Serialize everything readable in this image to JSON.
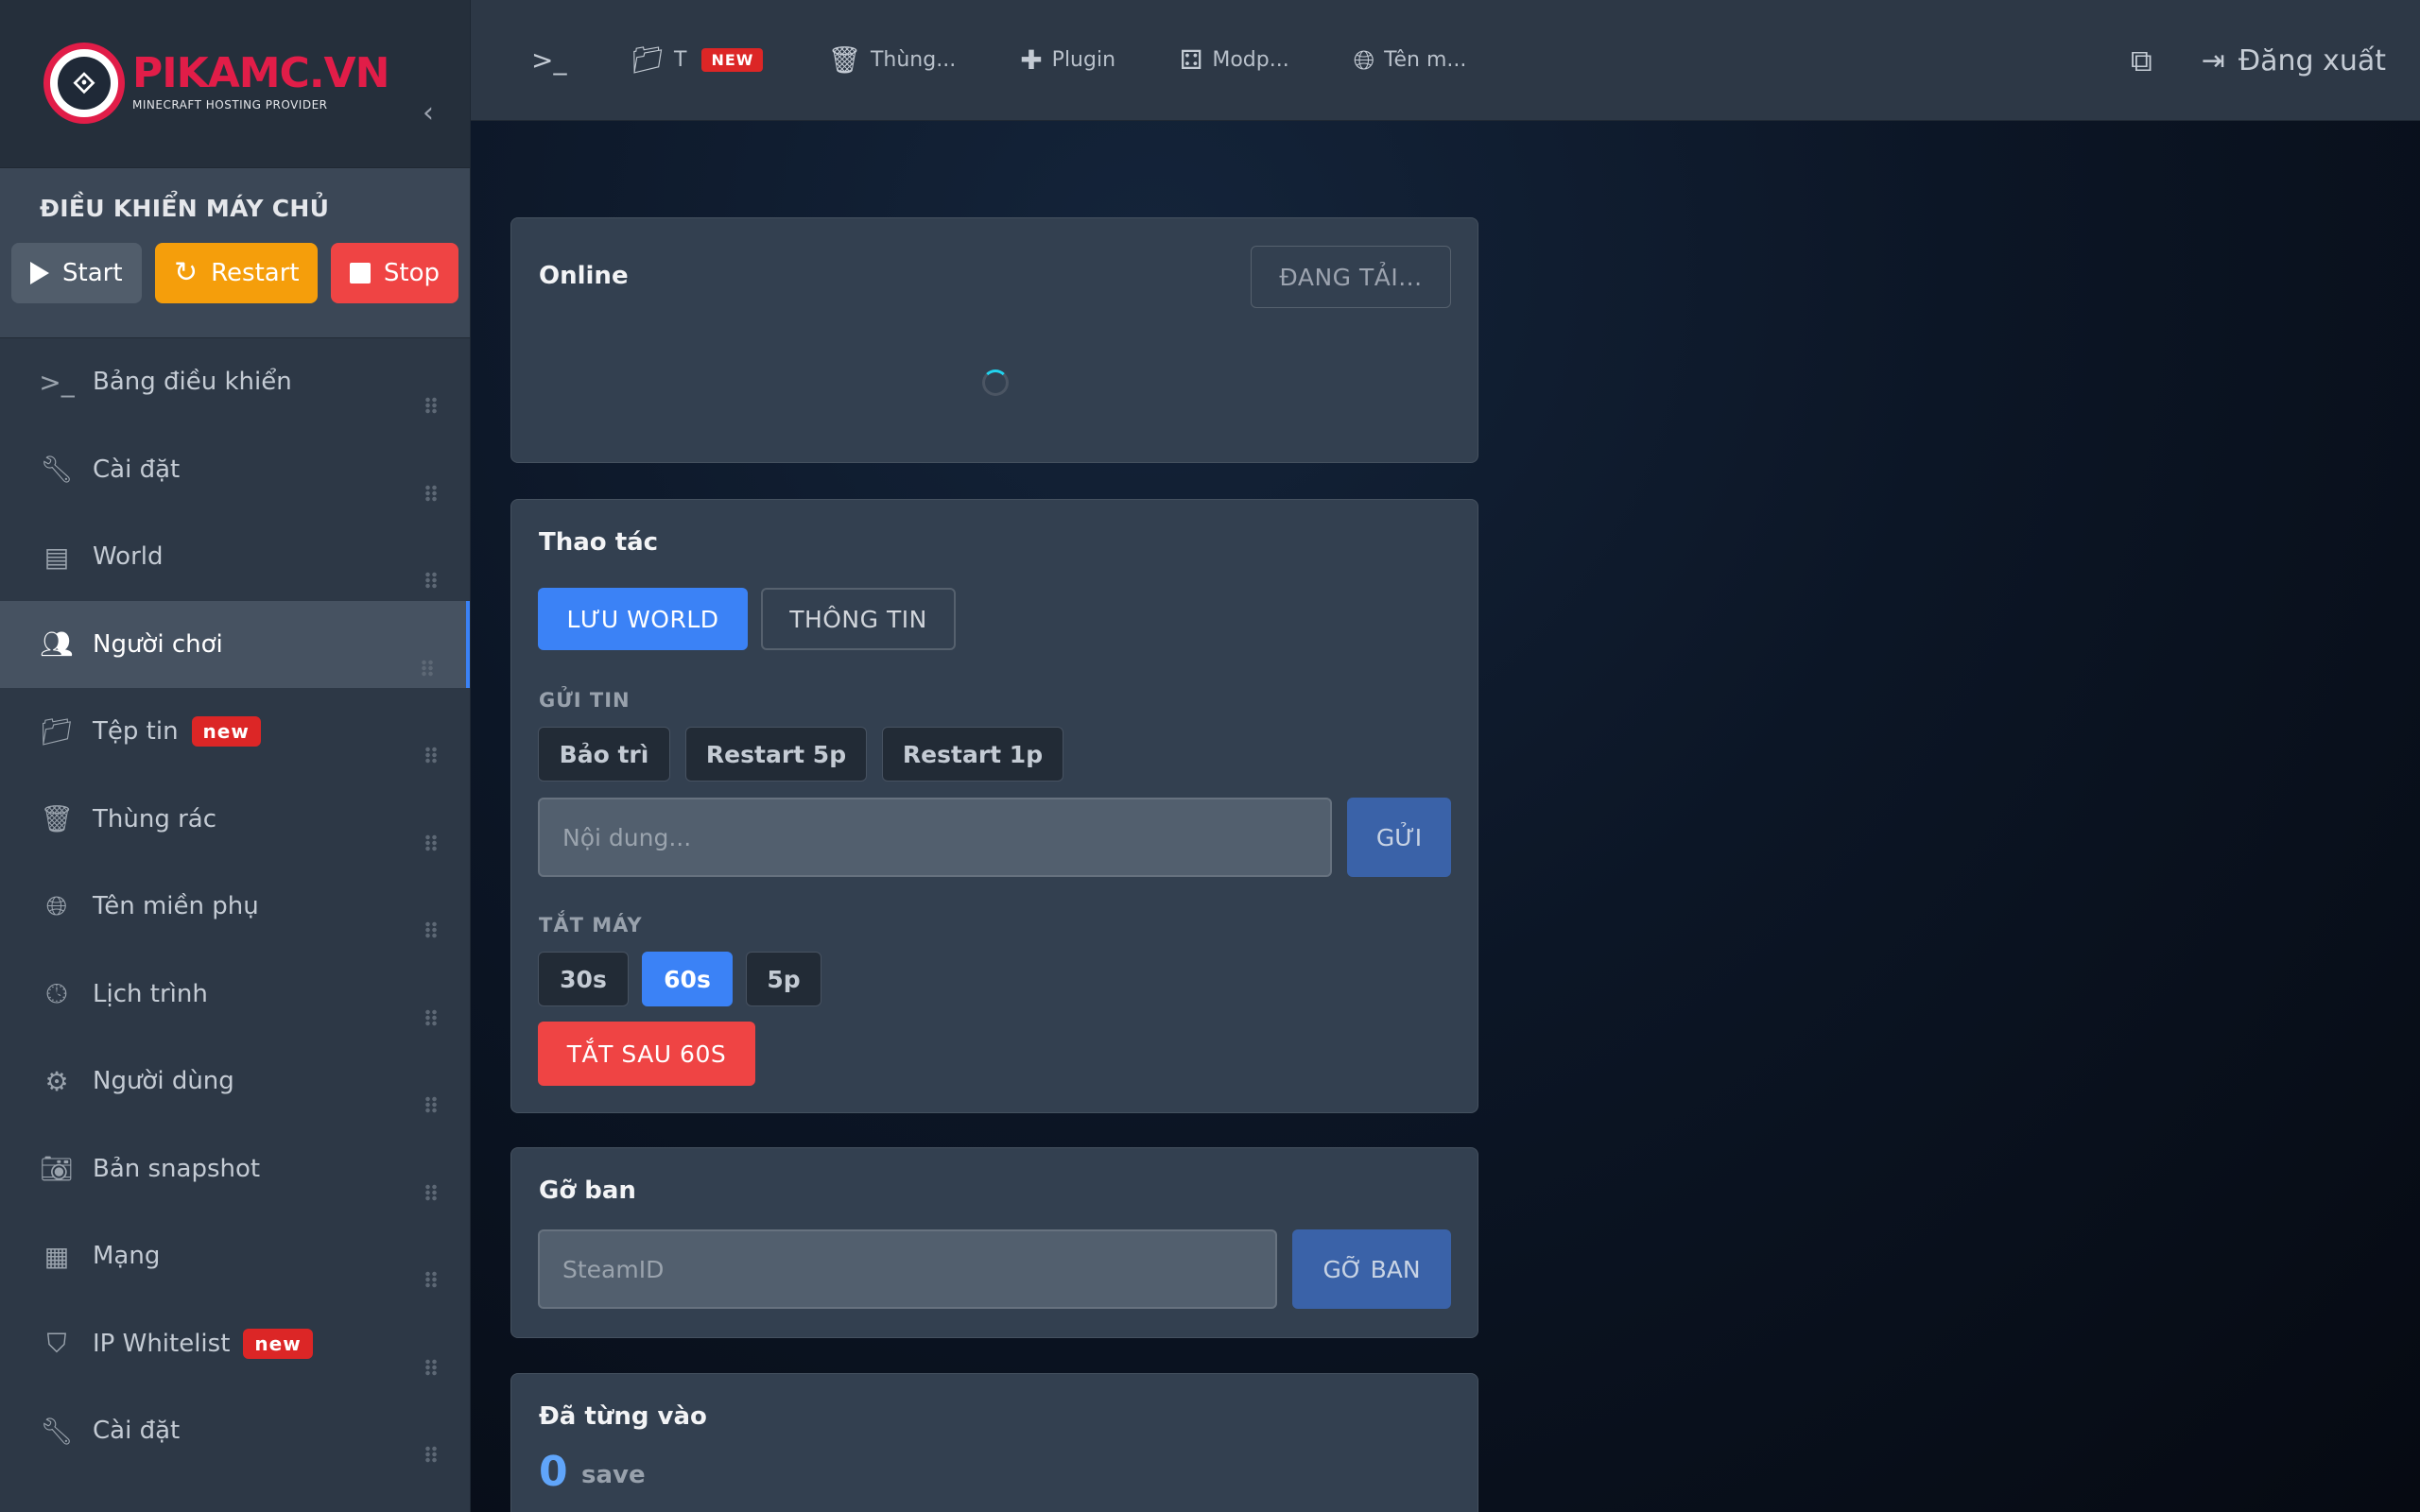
{
  "brand": {
    "name": "PIKAMC.VN",
    "tagline": "MINECRAFT HOSTING PROVIDER"
  },
  "server_control": {
    "title": "ĐIỀU KHIỂN MÁY CHỦ",
    "start_label": "Start",
    "restart_label": "Restart",
    "stop_label": "Stop"
  },
  "sidebar": {
    "items": [
      {
        "label": "Bảng điều khiển",
        "icon": "terminal-icon"
      },
      {
        "label": "Cài đặt",
        "icon": "wrench-icon"
      },
      {
        "label": "World",
        "icon": "archive-icon"
      },
      {
        "label": "Người chơi",
        "icon": "users-icon",
        "active": true
      },
      {
        "label": "Tệp tin",
        "icon": "folder-icon",
        "badge": "new"
      },
      {
        "label": "Thùng rác",
        "icon": "trash-icon"
      },
      {
        "label": "Tên miền phụ",
        "icon": "globe-icon"
      },
      {
        "label": "Lịch trình",
        "icon": "clock-icon"
      },
      {
        "label": "Người dùng",
        "icon": "user-gear-icon"
      },
      {
        "label": "Bản snapshot",
        "icon": "camera-icon"
      },
      {
        "label": "Mạng",
        "icon": "network-icon"
      },
      {
        "label": "IP Whitelist",
        "icon": "shield-icon",
        "badge": "new"
      },
      {
        "label": "Cài đặt",
        "icon": "wrench-icon"
      }
    ]
  },
  "topbar": {
    "items": [
      {
        "label": "",
        "icon": "terminal-icon"
      },
      {
        "label": "T",
        "icon": "folder-icon",
        "badge": "NEW"
      },
      {
        "label": "Thùng...",
        "icon": "trash-icon"
      },
      {
        "label": "Plugin",
        "icon": "puzzle-icon"
      },
      {
        "label": "Modp...",
        "icon": "cubes-icon"
      },
      {
        "label": "Tên m...",
        "icon": "globe-icon"
      }
    ],
    "logout_label": "Đăng xuất"
  },
  "online_card": {
    "title": "Online",
    "loading_label": "ĐANG TẢI..."
  },
  "actions_card": {
    "title": "Thao tác",
    "save_world_label": "LƯU WORLD",
    "info_label": "THÔNG TIN",
    "send_msg_section": "GỬI TIN",
    "presets": [
      "Bảo trì",
      "Restart 5p",
      "Restart 1p"
    ],
    "message_placeholder": "Nội dung...",
    "send_label": "GỬI",
    "shutdown_section": "TẮT MÁY",
    "timers": [
      "30s",
      "60s",
      "5p"
    ],
    "selected_timer": "60s",
    "shutdown_label": "TẮT SAU 60S"
  },
  "unban_card": {
    "title": "Gỡ ban",
    "steamid_placeholder": "SteamID",
    "unban_label": "GỠ BAN"
  },
  "joined_card": {
    "title": "Đã từng vào",
    "count": "0",
    "unit": "save"
  }
}
